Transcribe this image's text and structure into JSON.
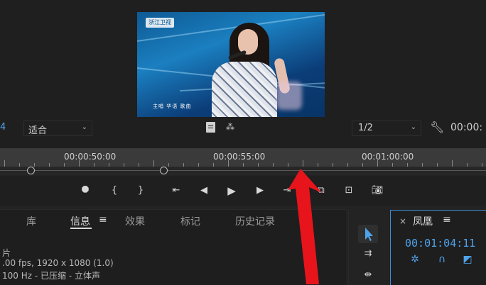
{
  "monitor": {
    "video_overlay": {
      "logo_text": "浙江卫视",
      "caption": "主唱  华语  歌曲"
    },
    "left_edge_digit": "4",
    "fit_dropdown": "适合",
    "resolution_dropdown": "1/2",
    "timecode_partial": "00:00:"
  },
  "ruler": {
    "ticks": [
      "00:00:50:00",
      "00:00:55:00",
      "00:01:00:00"
    ]
  },
  "transport_icons": [
    "marker-icon",
    "mark-in-icon",
    "mark-out-icon",
    "go-to-in-icon",
    "step-back-icon",
    "play-icon",
    "step-forward-icon",
    "go-to-out-icon",
    "insert-icon",
    "overwrite-icon",
    "export-frame-icon"
  ],
  "panels": {
    "tabs": [
      "库",
      "信息",
      "效果",
      "标记",
      "历史记录"
    ],
    "menu_glyph": "≡",
    "info": {
      "line1": "片",
      "line2": ".00 fps, 1920 x 1080 (1.0)",
      "line3": "100 Hz - 已压缩 - 立体声"
    }
  },
  "sequence": {
    "close": "×",
    "name": "凤凰",
    "menu_glyph": "≡",
    "timecode": "00:01:04:11"
  },
  "colors": {
    "accent_blue": "#4fa2ec",
    "arrow_red": "#e8141c"
  }
}
